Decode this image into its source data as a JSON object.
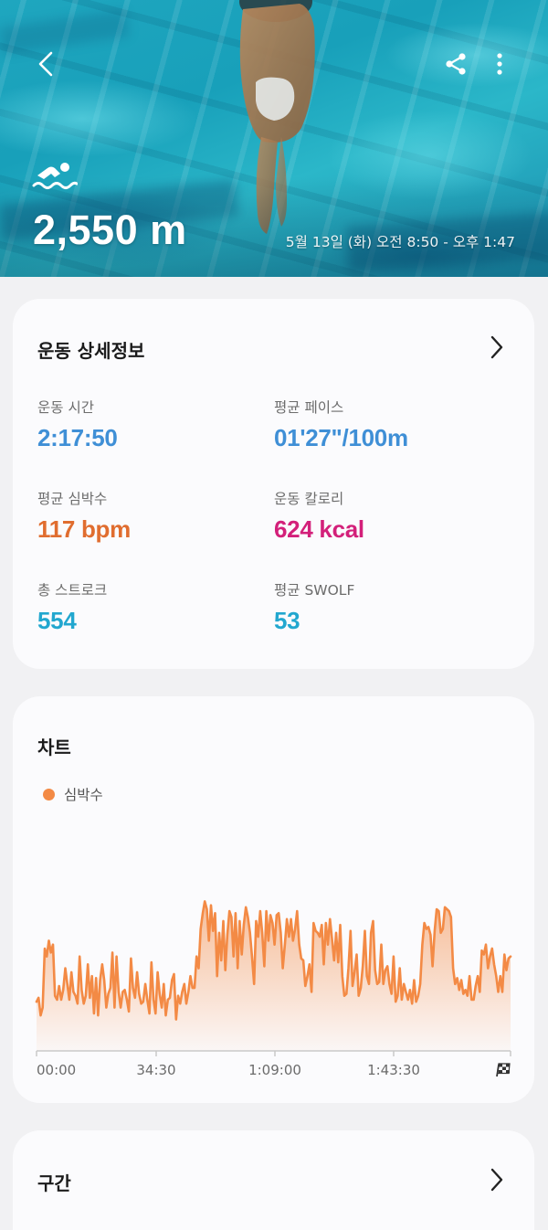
{
  "hero": {
    "distance": "2,550 m",
    "datetime": "5월 13일 (화) 오전 8:50 - 오후 1:47",
    "icons": {
      "back": "back-arrow-icon",
      "share": "share-icon",
      "more": "more-vertical-icon",
      "activity": "swimming-icon"
    }
  },
  "details": {
    "title": "운동 상세정보",
    "stats": [
      {
        "label": "운동 시간",
        "value": "2:17:50",
        "color": "#3f8fd6"
      },
      {
        "label": "평균 페이스",
        "value": "01'27\"/100m",
        "color": "#3f8fd6"
      },
      {
        "label": "평균 심박수",
        "value": "117 bpm",
        "color": "#e06d2f"
      },
      {
        "label": "운동 칼로리",
        "value": "624 kcal",
        "color": "#d3207a"
      },
      {
        "label": "총 스트로크",
        "value": "554",
        "color": "#22a7cf"
      },
      {
        "label": "평균 SWOLF",
        "value": "53",
        "color": "#22a7cf"
      }
    ]
  },
  "chart": {
    "title": "차트",
    "legend": "심박수",
    "line_color": "#f38a45",
    "x_ticks": [
      "00:00",
      "34:30",
      "1:09:00",
      "1:43:30"
    ],
    "finish_icon": "checkered-flag-icon"
  },
  "laps": {
    "title": "구간"
  },
  "chart_data": {
    "type": "area",
    "series": [
      {
        "name": "심박수",
        "values": [
          95,
          97,
          88,
          92,
          122,
          118,
          126,
          120,
          124,
          98,
          96,
          103,
          96,
          101,
          112,
          104,
          96,
          110,
          100,
          98,
          94,
          118,
          101,
          94,
          98,
          114,
          97,
          108,
          89,
          107,
          88,
          106,
          114,
          106,
          92,
          99,
          102,
          120,
          92,
          118,
          100,
          92,
          100,
          101,
          96,
          90,
          117,
          102,
          97,
          110,
          99,
          94,
          95,
          104,
          96,
          89,
          115,
          96,
          89,
          110,
          99,
          92,
          104,
          88,
          96,
          97,
          106,
          109,
          86,
          98,
          94,
          100,
          104,
          94,
          100,
          108,
          102,
          102,
          118,
          112,
          132,
          140,
          146,
          142,
          126,
          144,
          131,
          140,
          108,
          130,
          116,
          136,
          111,
          129,
          141,
          138,
          118,
          140,
          112,
          136,
          119,
          134,
          143,
          138,
          130,
          118,
          104,
          136,
          128,
          141,
          130,
          113,
          141,
          126,
          139,
          135,
          124,
          139,
          140,
          130,
          112,
          124,
          137,
          128,
          137,
          126,
          132,
          141,
          124,
          117,
          116,
          103,
          108,
          114,
          100,
          135,
          131,
          130,
          128,
          134,
          114,
          135,
          124,
          137,
          127,
          116,
          130,
          115,
          134,
          108,
          98,
          99,
          112,
          131,
          103,
          110,
          119,
          98,
          102,
          113,
          131,
          108,
          104,
          130,
          136,
          111,
          104,
          105,
          124,
          104,
          111,
          113,
          104,
          99,
          118,
          95,
          98,
          112,
          96,
          104,
          100,
          96,
          101,
          94,
          106,
          95,
          98,
          104,
          124,
          135,
          132,
          133,
          129,
          113,
          131,
          142,
          141,
          130,
          132,
          143,
          142,
          141,
          138,
          112,
          104,
          107,
          101,
          106,
          99,
          101,
          98,
          108,
          96,
          96,
          103,
          108,
          100,
          121,
          119,
          124,
          112,
          118,
          122,
          114,
          108,
          100,
          108,
          100,
          119,
          111,
          117,
          118
        ]
      }
    ],
    "x_tick_labels": [
      "00:00",
      "34:30",
      "1:09:00",
      "1:43:30"
    ],
    "x_unit": "elapsed time",
    "ylim": [
      70,
      155
    ]
  }
}
